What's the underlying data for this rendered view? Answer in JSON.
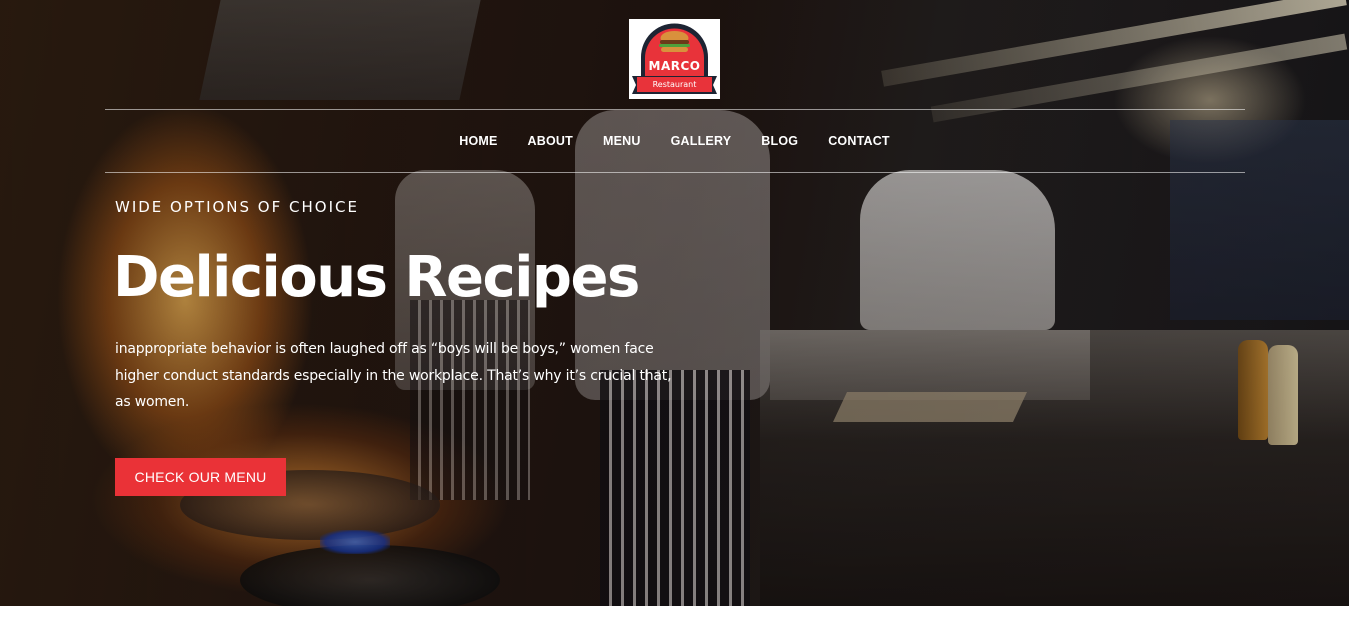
{
  "logo": {
    "name": "MARCO",
    "subtitle": "Restaurant",
    "icon": "burger-icon",
    "colors": {
      "red": "#e8333a",
      "dark": "#1d2433"
    }
  },
  "nav": {
    "items": [
      {
        "label": "HOME"
      },
      {
        "label": "ABOUT"
      },
      {
        "label": "MENU"
      },
      {
        "label": "GALLERY"
      },
      {
        "label": "BLOG"
      },
      {
        "label": "CONTACT"
      }
    ]
  },
  "hero": {
    "eyebrow": "WIDE OPTIONS OF CHOICE",
    "title": "Delicious Recipes",
    "description": "inappropriate behavior is often laughed off as “boys will be boys,” women face higher conduct standards especially in the workplace. That’s why it’s crucial that, as women.",
    "cta_label": "CHECK OUR MENU",
    "cta_color": "#ea3237"
  }
}
